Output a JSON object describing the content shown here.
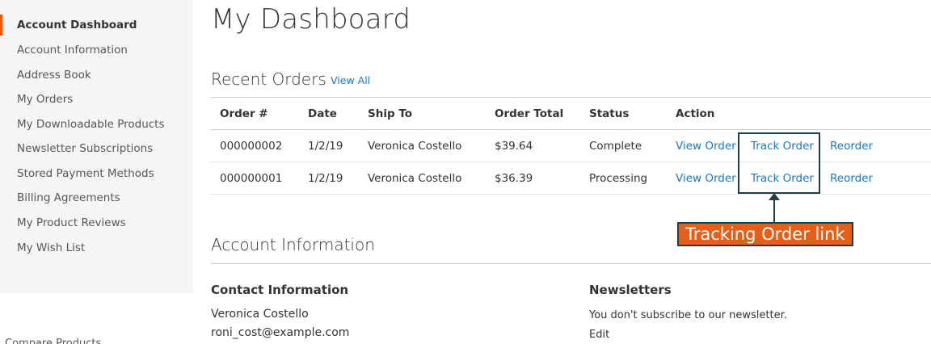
{
  "sidebar": {
    "items": [
      {
        "label": "Account Dashboard",
        "active": true
      },
      {
        "label": "Account Information"
      },
      {
        "label": "Address Book"
      },
      {
        "label": "My Orders"
      },
      {
        "label": "My Downloadable Products"
      },
      {
        "label": "Newsletter Subscriptions"
      },
      {
        "label": "Stored Payment Methods"
      },
      {
        "label": "Billing Agreements"
      },
      {
        "label": "My Product Reviews"
      },
      {
        "label": "My Wish List"
      }
    ],
    "cut_off_label": "Compare Products"
  },
  "page": {
    "title": "My Dashboard"
  },
  "recent_orders": {
    "title": "Recent Orders",
    "view_all": "View All",
    "headers": [
      "Order #",
      "Date",
      "Ship To",
      "Order Total",
      "Status",
      "Action"
    ],
    "rows": [
      {
        "order": "000000002",
        "date": "1/2/19",
        "ship_to": "Veronica Costello",
        "total": "$39.64",
        "status": "Complete",
        "view": "View Order",
        "track": "Track Order",
        "reorder": "Reorder"
      },
      {
        "order": "000000001",
        "date": "1/2/19",
        "ship_to": "Veronica Costello",
        "total": "$36.39",
        "status": "Processing",
        "view": "View Order",
        "track": "Track Order",
        "reorder": "Reorder"
      }
    ]
  },
  "annotation": {
    "label": "Tracking Order link",
    "color": "#e45f1a",
    "border_color": "#1f3e47"
  },
  "account_info": {
    "title": "Account Information",
    "contact": {
      "title": "Contact Information",
      "name": "Veronica Costello",
      "email": "roni_cost@example.com"
    },
    "newsletters": {
      "title": "Newsletters",
      "text": "You don't subscribe to our newsletter.",
      "edit": "Edit"
    }
  },
  "colors": {
    "accent": "#ff5501",
    "link": "#1979c3",
    "sidebar_bg": "#f5f5f5"
  }
}
